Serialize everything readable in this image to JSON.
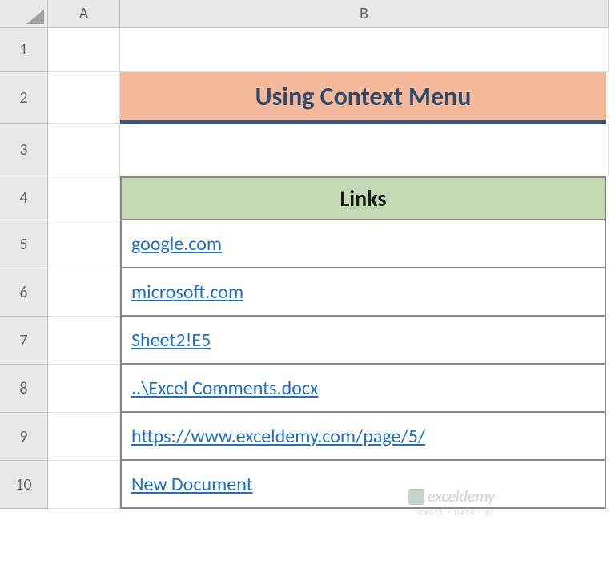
{
  "columns": {
    "A": "A",
    "B": "B"
  },
  "rows": [
    "1",
    "2",
    "3",
    "4",
    "5",
    "6",
    "7",
    "8",
    "9",
    "10"
  ],
  "title": "Using Context Menu",
  "table": {
    "header": "Links",
    "links": [
      "google.com",
      "microsoft.com",
      "Sheet2!E5",
      "..\\Excel Comments.docx",
      "https://www.exceldemy.com/page/5/",
      "New Document"
    ]
  },
  "watermark": {
    "brand": "exceldemy",
    "tagline": "EXCEL · DATA · BI"
  }
}
